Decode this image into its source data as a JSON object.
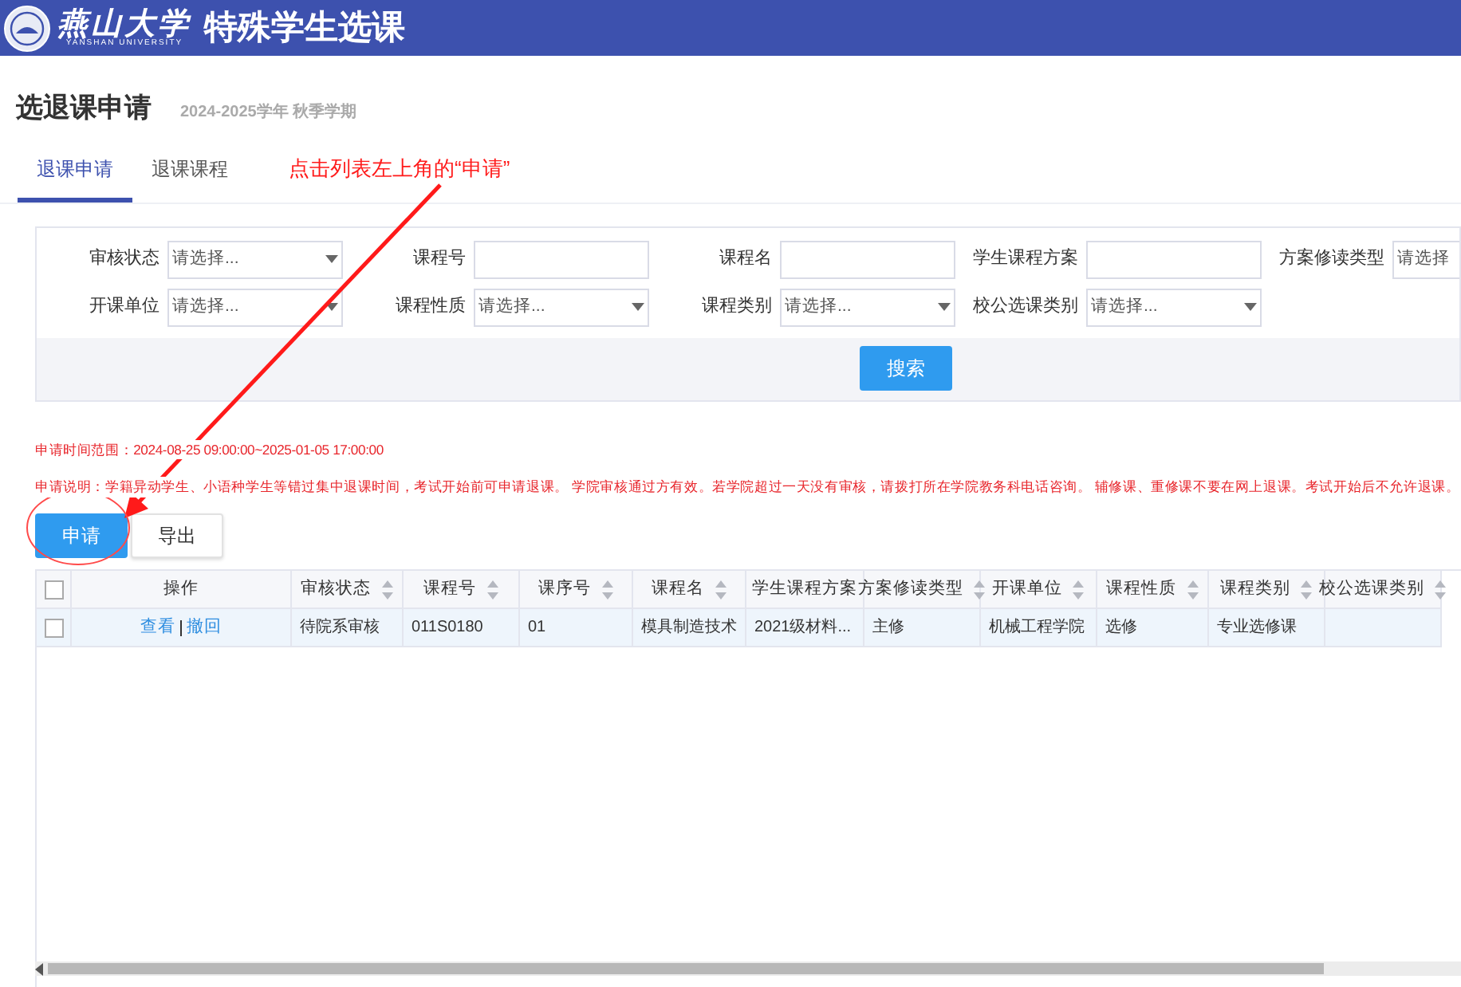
{
  "header": {
    "logo_text": "燕山大学",
    "logo_subtext": "YANSHAN UNIVERSITY",
    "title": "特殊学生选课"
  },
  "page": {
    "title": "选退课申请",
    "term": "2024-2025学年 秋季学期"
  },
  "tabs": [
    {
      "label": "退课申请",
      "selected": true
    },
    {
      "label": "退课课程",
      "selected": false
    }
  ],
  "annotation": {
    "text": "点击列表左上角的“申请”"
  },
  "filters": [
    {
      "label": "审核状态",
      "kind": "select",
      "value": "请选择..."
    },
    {
      "label": "课程号",
      "kind": "text"
    },
    {
      "label": "课程名",
      "kind": "text"
    },
    {
      "label": "学生课程方案",
      "kind": "text"
    },
    {
      "label": "方案修读类型",
      "kind": "select",
      "value": "请选择"
    },
    {
      "label": "开课单位",
      "kind": "select",
      "value": "请选择..."
    },
    {
      "label": "课程性质",
      "kind": "select",
      "value": "请选择..."
    },
    {
      "label": "课程类别",
      "kind": "select",
      "value": "请选择..."
    },
    {
      "label": "校公选课类别",
      "kind": "select",
      "value": "请选择..."
    }
  ],
  "search_button": "搜索",
  "notes": [
    "申请时间范围：2024-08-25 09:00:00~2025-01-05 17:00:00",
    "申请说明：学籍异动学生、小语种学生等错过集中退课时间，考试开始前可申请退课。 学院审核通过方有效。若学院超过一天没有审核，请拨打所在学院教务科电话咨询。 辅修课、重修课不要在网上退课。考试开始后不允许退课。"
  ],
  "buttons": [
    {
      "label": "申请",
      "kind": "primary"
    },
    {
      "label": "导出",
      "kind": "secondary"
    }
  ],
  "table": {
    "all_checked": false,
    "columns": [
      {
        "label": "操作",
        "sortable": false
      },
      {
        "label": "审核状态",
        "sortable": true
      },
      {
        "label": "课程号",
        "sortable": true
      },
      {
        "label": "课序号",
        "sortable": true
      },
      {
        "label": "课程名",
        "sortable": true
      },
      {
        "label": "学生课程方案",
        "sortable": false
      },
      {
        "label": "方案修读类型",
        "sortable": true
      },
      {
        "label": "开课单位",
        "sortable": true
      },
      {
        "label": "课程性质",
        "sortable": true
      },
      {
        "label": "课程类别",
        "sortable": true
      },
      {
        "label": "校公选课类别",
        "sortable": true
      }
    ],
    "rows": [
      {
        "checked": false,
        "actions": [
          "查看",
          "撤回"
        ],
        "cells": [
          "",
          "待院系审核",
          "011S0180",
          "01",
          "模具制造技术",
          "2021级材料...",
          "主修",
          "机械工程学院",
          "选修",
          "专业选修课",
          ""
        ]
      }
    ]
  }
}
